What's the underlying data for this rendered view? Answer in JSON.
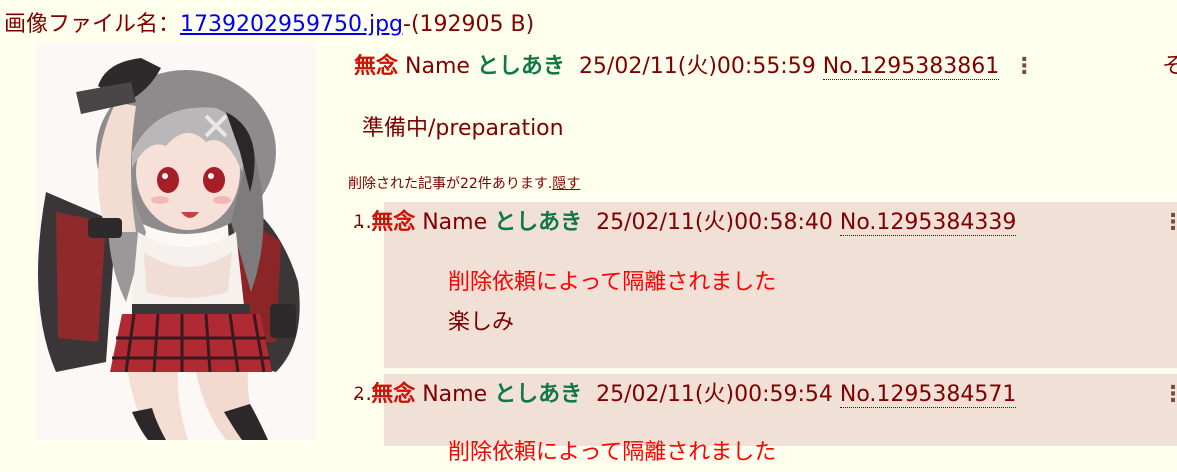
{
  "file": {
    "label": "画像ファイル名：",
    "filename": "1739202959750.jpg",
    "size": "-(192905 B)"
  },
  "thread": {
    "subject": "無念",
    "name_label": "Name",
    "poster": "としあき",
    "datetime": "25/02/11(火)00:55:59",
    "number": "No.1295383861",
    "cut_char": "そ",
    "body": "準備中/preparation",
    "deleted_note": "削除された記事が22件あります.",
    "hide_link": "隠す"
  },
  "replies": [
    {
      "ellipsis": "…",
      "index": "1",
      "subject": "無念",
      "name_label": "Name",
      "poster": "としあき",
      "datetime": "25/02/11(火)00:58:40",
      "number": "No.1295384339",
      "removed_notice": "削除依頼によって隔離されました",
      "body": "楽しみ"
    },
    {
      "ellipsis": "…",
      "index": "2",
      "subject": "無念",
      "name_label": "Name",
      "poster": "としあき",
      "datetime": "25/02/11(火)00:59:54",
      "number": "No.1295384571",
      "removed_notice": "削除依頼によって隔離されました"
    }
  ],
  "icons": {
    "menu": "vertical-dots-icon"
  },
  "colors": {
    "background": "#ffffee",
    "text": "#800000",
    "subject": "#cc1105",
    "poster": "#117743",
    "reply_background": "#f0e0d6",
    "link": "#0000ee",
    "removed_notice": "#ff0000"
  }
}
